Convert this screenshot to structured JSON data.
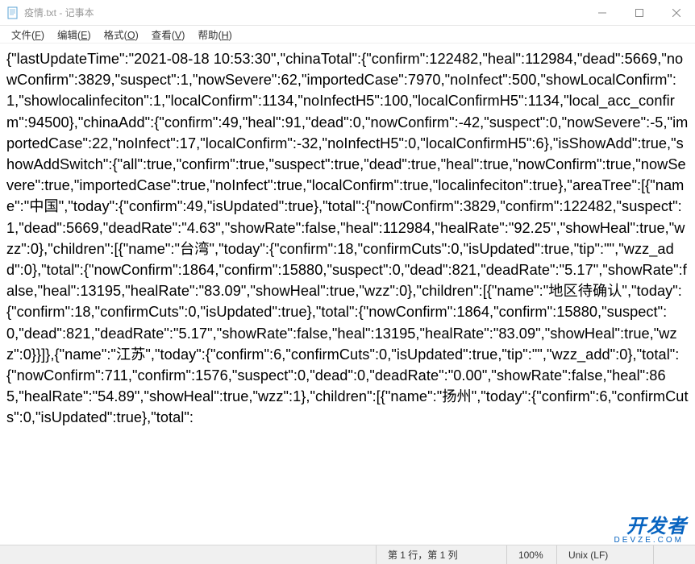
{
  "window": {
    "title": "疫情.txt - 记事本"
  },
  "menu": {
    "file": "文件(F)",
    "edit": "编辑(E)",
    "format": "格式(O)",
    "view": "查看(V)",
    "help": "帮助(H)"
  },
  "content": "{\"lastUpdateTime\":\"2021-08-18 10:53:30\",\"chinaTotal\":{\"confirm\":122482,\"heal\":112984,\"dead\":5669,\"nowConfirm\":3829,\"suspect\":1,\"nowSevere\":62,\"importedCase\":7970,\"noInfect\":500,\"showLocalConfirm\":1,\"showlocalinfeciton\":1,\"localConfirm\":1134,\"noInfectH5\":100,\"localConfirmH5\":1134,\"local_acc_confirm\":94500},\"chinaAdd\":{\"confirm\":49,\"heal\":91,\"dead\":0,\"nowConfirm\":-42,\"suspect\":0,\"nowSevere\":-5,\"importedCase\":22,\"noInfect\":17,\"localConfirm\":-32,\"noInfectH5\":0,\"localConfirmH5\":6},\"isShowAdd\":true,\"showAddSwitch\":{\"all\":true,\"confirm\":true,\"suspect\":true,\"dead\":true,\"heal\":true,\"nowConfirm\":true,\"nowSevere\":true,\"importedCase\":true,\"noInfect\":true,\"localConfirm\":true,\"localinfeciton\":true},\"areaTree\":[{\"name\":\"中国\",\"today\":{\"confirm\":49,\"isUpdated\":true},\"total\":{\"nowConfirm\":3829,\"confirm\":122482,\"suspect\":1,\"dead\":5669,\"deadRate\":\"4.63\",\"showRate\":false,\"heal\":112984,\"healRate\":\"92.25\",\"showHeal\":true,\"wzz\":0},\"children\":[{\"name\":\"台湾\",\"today\":{\"confirm\":18,\"confirmCuts\":0,\"isUpdated\":true,\"tip\":\"\",\"wzz_add\":0},\"total\":{\"nowConfirm\":1864,\"confirm\":15880,\"suspect\":0,\"dead\":821,\"deadRate\":\"5.17\",\"showRate\":false,\"heal\":13195,\"healRate\":\"83.09\",\"showHeal\":true,\"wzz\":0},\"children\":[{\"name\":\"地区待确认\",\"today\":{\"confirm\":18,\"confirmCuts\":0,\"isUpdated\":true},\"total\":{\"nowConfirm\":1864,\"confirm\":15880,\"suspect\":0,\"dead\":821,\"deadRate\":\"5.17\",\"showRate\":false,\"heal\":13195,\"healRate\":\"83.09\",\"showHeal\":true,\"wzz\":0}}]},{\"name\":\"江苏\",\"today\":{\"confirm\":6,\"confirmCuts\":0,\"isUpdated\":true,\"tip\":\"\",\"wzz_add\":0},\"total\":{\"nowConfirm\":711,\"confirm\":1576,\"suspect\":0,\"dead\":0,\"deadRate\":\"0.00\",\"showRate\":false,\"heal\":865,\"healRate\":\"54.89\",\"showHeal\":true,\"wzz\":1},\"children\":[{\"name\":\"扬州\",\"today\":{\"confirm\":6,\"confirmCuts\":0,\"isUpdated\":true},\"total\":",
  "statusbar": {
    "position": "第 1 行，第 1 列",
    "zoom": "100%",
    "lineending": "Unix (LF)",
    "encoding": ""
  },
  "watermark": {
    "main": "开发者",
    "sub": "DEVZE.COM"
  }
}
